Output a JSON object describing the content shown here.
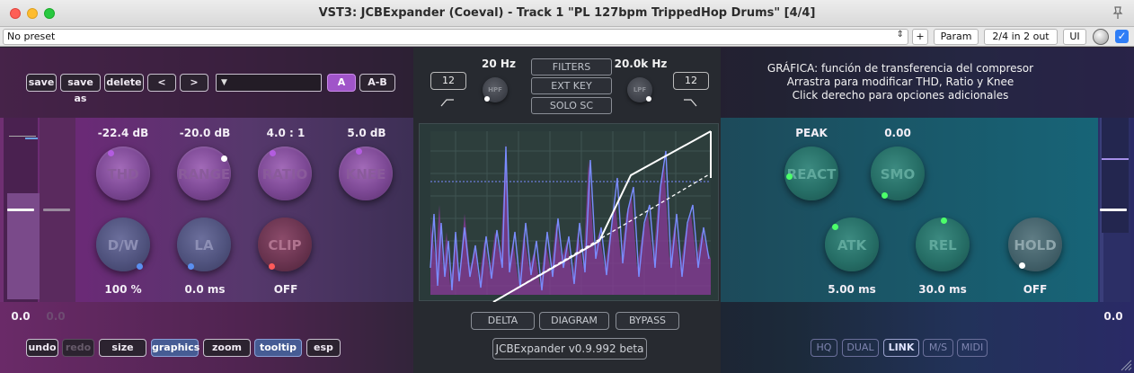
{
  "window": {
    "title": "VST3: JCBExpander (Coeval) - Track 1 \"PL 127bpm TrippedHop Drums\" [4/4]"
  },
  "host": {
    "preset": "No preset",
    "plus_label": "+",
    "param_label": "Param",
    "io_label": "2/4 in 2 out",
    "ui_label": "UI"
  },
  "toolbar": {
    "save": "save",
    "save_as": "save as",
    "delete": "delete",
    "prev": "<",
    "next": ">",
    "preset_name": "",
    "a": "A",
    "ab": "A-B"
  },
  "filters": {
    "hpf_freq": "20 Hz",
    "lpf_freq": "20.0k Hz",
    "hpf_label": "HPF",
    "lpf_label": "LPF",
    "hpf_slope": "12",
    "lpf_slope": "12",
    "filters_btn": "FILTERS",
    "extkey_btn": "EXT KEY",
    "solosc_btn": "SOLO SC"
  },
  "info": {
    "line1": "GRÁFICA: función de transferencia del compresor",
    "line2": "Arrastra para modificar THD, Ratio y Knee",
    "line3": "Click derecho para opciones adicionales"
  },
  "left_knobs": {
    "thd": {
      "label": "THD",
      "value": "-22.4 dB"
    },
    "range": {
      "label": "RANGE",
      "value": "-20.0 dB"
    },
    "ratio": {
      "label": "RATIO",
      "value": "4.0 : 1"
    },
    "knee": {
      "label": "KNEE",
      "value": "5.0 dB"
    },
    "dw": {
      "label": "D/W",
      "value": "100 %"
    },
    "la": {
      "label": "LA",
      "value": "0.0 ms"
    },
    "clip": {
      "label": "CLIP",
      "value": "OFF"
    }
  },
  "right_knobs": {
    "react": {
      "label": "REACT",
      "value": "PEAK"
    },
    "smo": {
      "label": "SMO",
      "value": "0.00"
    },
    "atk": {
      "label": "ATK",
      "value": "5.00 ms"
    },
    "rel": {
      "label": "REL",
      "value": "30.0 ms"
    },
    "hold": {
      "label": "HOLD",
      "value": "OFF"
    }
  },
  "meters": {
    "left_value": "0.0",
    "left_value2": "0.0",
    "right_value": "0.0"
  },
  "center_buttons": {
    "delta": "DELTA",
    "diagram": "DIAGRAM",
    "bypass": "BYPASS",
    "version": "JCBExpander v0.9.992 beta"
  },
  "bottom_left": {
    "undo": "undo",
    "redo": "redo",
    "size": "size",
    "graphics": "graphics",
    "zoom": "zoom",
    "tooltip": "tooltip",
    "esp": "esp"
  },
  "bottom_right": {
    "hq": "HQ",
    "dual": "DUAL",
    "link": "LINK",
    "ms": "M/S",
    "midi": "MIDI"
  },
  "colors": {
    "accent_purple": "#a054c9",
    "accent_blue": "#465c94",
    "dot_purple": "#b35ce0",
    "dot_white": "#ffffff",
    "dot_blue": "#5a8ff0",
    "dot_red": "#ff5a5a",
    "dot_green": "#4cff6a"
  }
}
